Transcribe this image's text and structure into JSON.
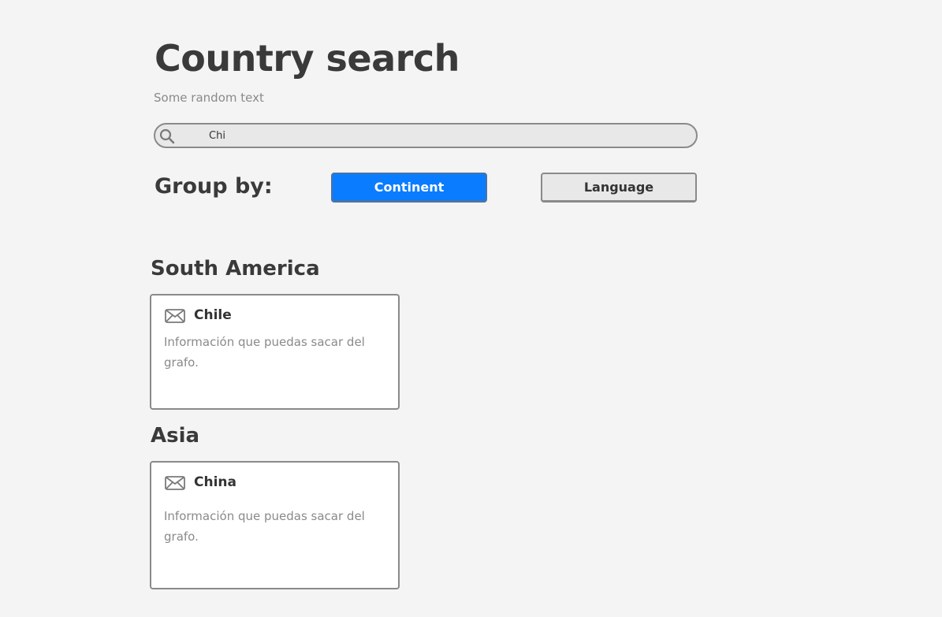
{
  "header": {
    "title": "Country search",
    "subtitle": "Some random text"
  },
  "search": {
    "value": "Chi",
    "icon": "search-icon"
  },
  "group_by": {
    "label": "Group by:",
    "options": [
      {
        "label": "Continent",
        "selected": true
      },
      {
        "label": "Language",
        "selected": false
      }
    ]
  },
  "colors": {
    "accent": "#0a7cff",
    "background": "#f4f4f4",
    "muted_text": "#8a8a8a"
  },
  "groups": [
    {
      "name": "South America",
      "cards": [
        {
          "title": "Chile",
          "description": "Información que puedas sacar del grafo.",
          "icon": "envelope-icon"
        }
      ]
    },
    {
      "name": "Asia",
      "cards": [
        {
          "title": "China",
          "description": "Información que puedas sacar del grafo.",
          "icon": "envelope-icon"
        }
      ]
    }
  ]
}
